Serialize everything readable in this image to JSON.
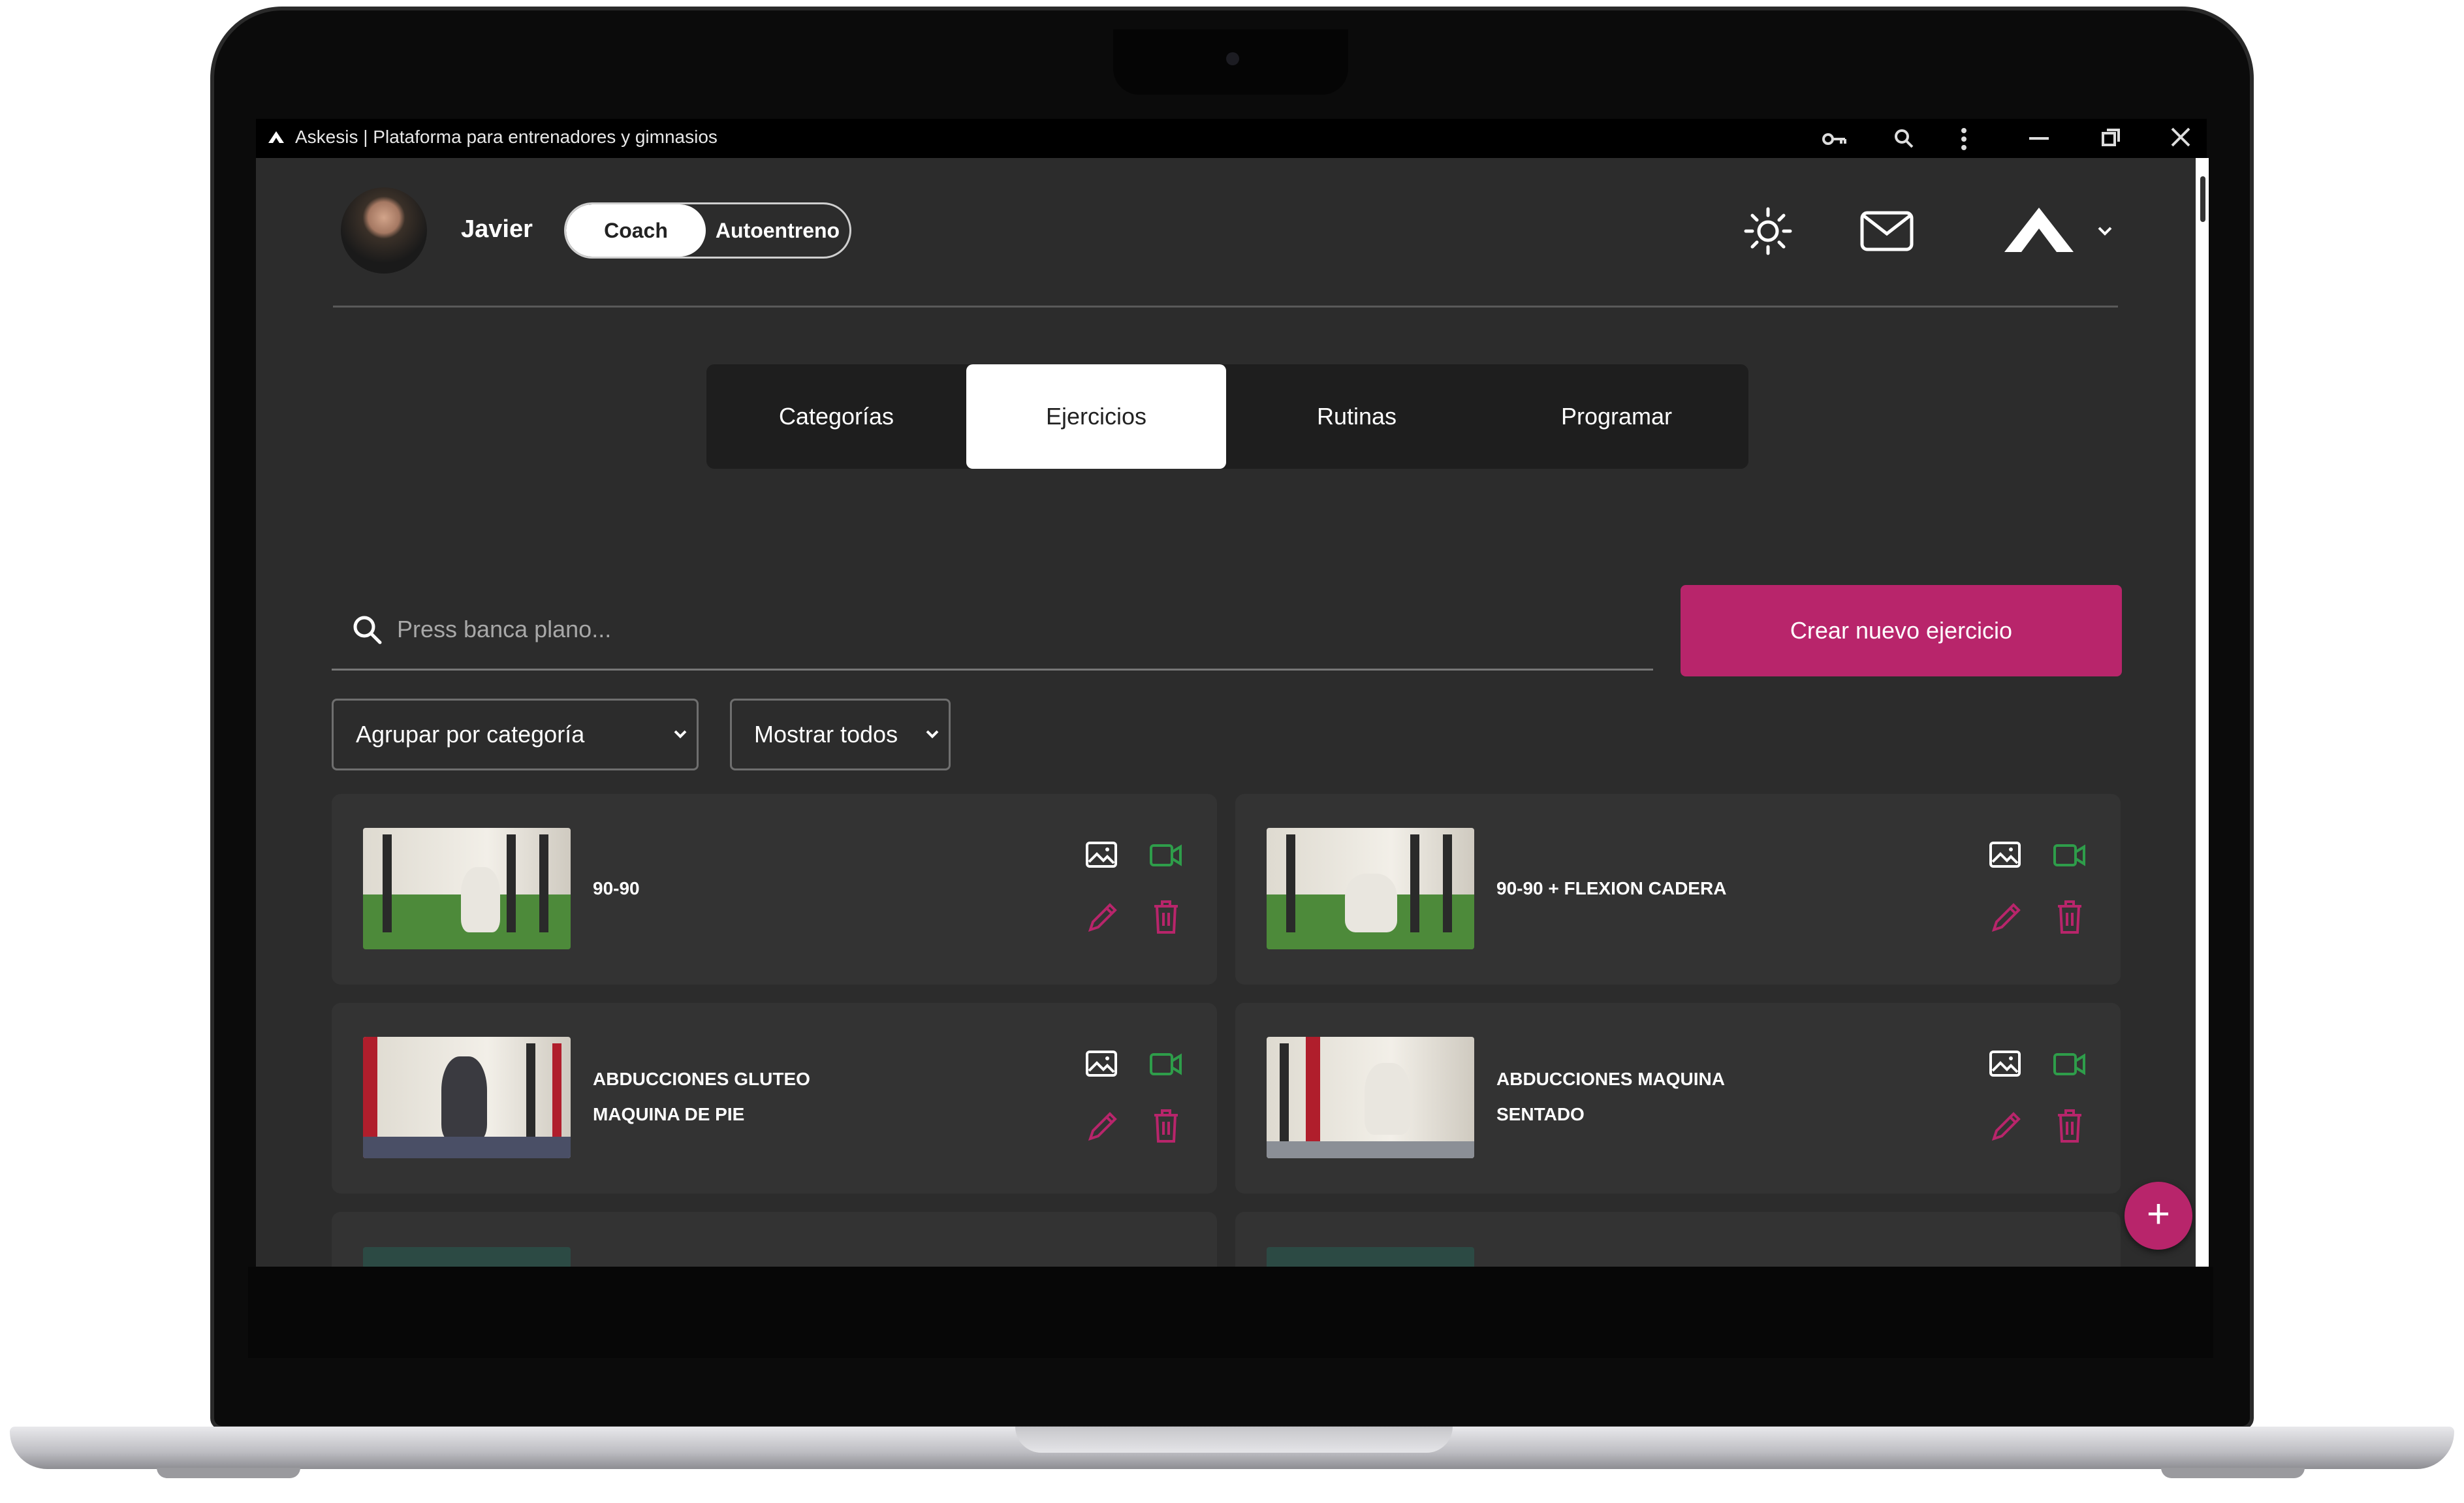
{
  "window": {
    "title": "Askesis | Plataforma para entrenadores y gimnasios",
    "controls": [
      "key-icon",
      "zoom-icon",
      "more-icon",
      "minimize-icon",
      "restore-icon",
      "close-icon"
    ]
  },
  "header": {
    "user_name": "Javier",
    "mode_toggle": {
      "active": "Coach",
      "inactive": "Autoentreno"
    },
    "icons": [
      "brightness-icon",
      "mail-icon",
      "brand-logo",
      "chevron-down-icon"
    ]
  },
  "tabs": [
    {
      "label": "Categorías",
      "active": false
    },
    {
      "label": "Ejercicios",
      "active": true
    },
    {
      "label": "Rutinas",
      "active": false
    },
    {
      "label": "Programar",
      "active": false
    }
  ],
  "search": {
    "placeholder": "Press banca plano..."
  },
  "create_button": {
    "label": "Crear nuevo ejercicio"
  },
  "filters": {
    "group_by": {
      "selected": "Agrupar por categoría"
    },
    "show": {
      "selected": "Mostrar todos"
    }
  },
  "exercises": [
    {
      "line1": "90-90",
      "line2": ""
    },
    {
      "line1": "90-90 + FLEXION CADERA",
      "line2": ""
    },
    {
      "line1": "ABDUCCIONES GLUTEO",
      "line2": "MAQUINA DE PIE"
    },
    {
      "line1": "ABDUCCIONES MAQUINA",
      "line2": "SENTADO"
    }
  ],
  "fab": {
    "label": "+"
  },
  "colors": {
    "accent": "#b8256b",
    "background": "#2c2c2c",
    "card": "#333333",
    "video_icon": "#2e9d4a",
    "edit_delete_icon": "#b8256b"
  }
}
